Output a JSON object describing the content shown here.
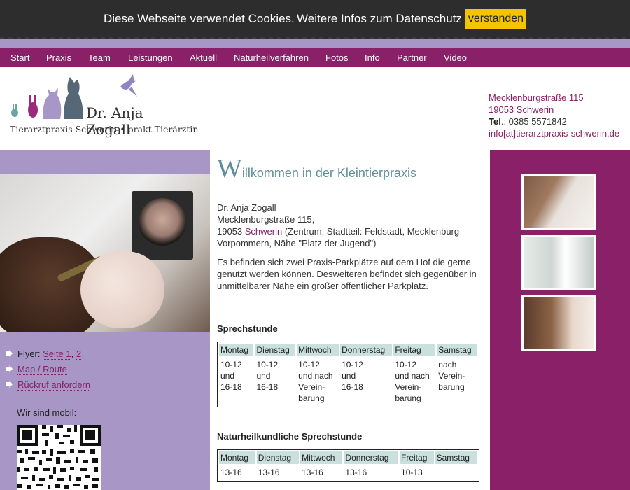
{
  "cookie": {
    "message": "Diese Webseite verwendet Cookies.",
    "more_link": "Weitere Infos zum Datenschutz",
    "accept_button": "verstanden"
  },
  "nav": [
    "Start",
    "Praxis",
    "Team",
    "Leistungen",
    "Aktuell",
    "Naturheilverfahren",
    "Fotos",
    "Info",
    "Partner",
    "Video"
  ],
  "logo": {
    "name": "Dr. Anja Zogall",
    "tagline": "Tierarztpraxis Schwerin • prakt.Tierärztin"
  },
  "contact": {
    "street": "Mecklenburgstraße 115",
    "city": "19053 Schwerin",
    "tel_label": "Tel",
    "tel": ".: 0385 5571842",
    "email": "info[at]tierarztpraxis-schwerin.de"
  },
  "sidebar": {
    "flyer_label": "Flyer: ",
    "flyer_pages": [
      "Seite 1",
      "2"
    ],
    "map_link": "Map / Route",
    "callback_link": "Rückruf anfordern",
    "mobile_label": "Wir sind mobil:"
  },
  "main": {
    "welcome_initial": "W",
    "welcome_rest": "illkommen in der Kleintierpraxis",
    "address_name": "Dr. Anja Zogall",
    "address_street": "Mecklenburgstraße 115,",
    "address_zip": "19053 ",
    "address_city_link": "Schwerin",
    "address_rest": " (Zentrum, Stadtteil: Feldstadt, Mecklenburg-Vorpommern, Nähe \"Platz der Jugend\")",
    "parking_text": "Es befinden sich zwei Praxis-Parkplätze auf dem Hof die gerne genutzt werden können. Desweiteren befindet sich gegenüber in unmittelbarer Nähe ein großer öffentlicher Parkplatz.",
    "hours_title": "Sprechstunde",
    "hours_days": [
      "Montag",
      "Dienstag",
      "Mittwoch",
      "Donnerstag",
      "Freitag",
      "Samstag"
    ],
    "hours_values": [
      "10-12\nund\n16-18",
      "10-12\nund\n16-18",
      "10-12\nund nach\nVerein-\nbarung",
      "10-12\nund\n16-18",
      "10-12\nund nach\nVerein-\nbarung",
      "nach\nVerein-\nbarung"
    ],
    "natur_title": "Naturheilkundliche Sprechstunde",
    "natur_days": [
      "Montag",
      "Dienstag",
      "Mittwoch",
      "Donnerstag",
      "Freitag",
      "Samstag"
    ],
    "natur_values": [
      "13-16",
      "13-16",
      "13-16",
      "13-16",
      "10-13",
      ""
    ]
  },
  "colors": {
    "brand_purple": "#8a2068",
    "lavender": "#a796c6",
    "heading_teal": "#5d8f9a",
    "table_header": "#c9e0dd",
    "cookie_button": "#f2c500"
  }
}
